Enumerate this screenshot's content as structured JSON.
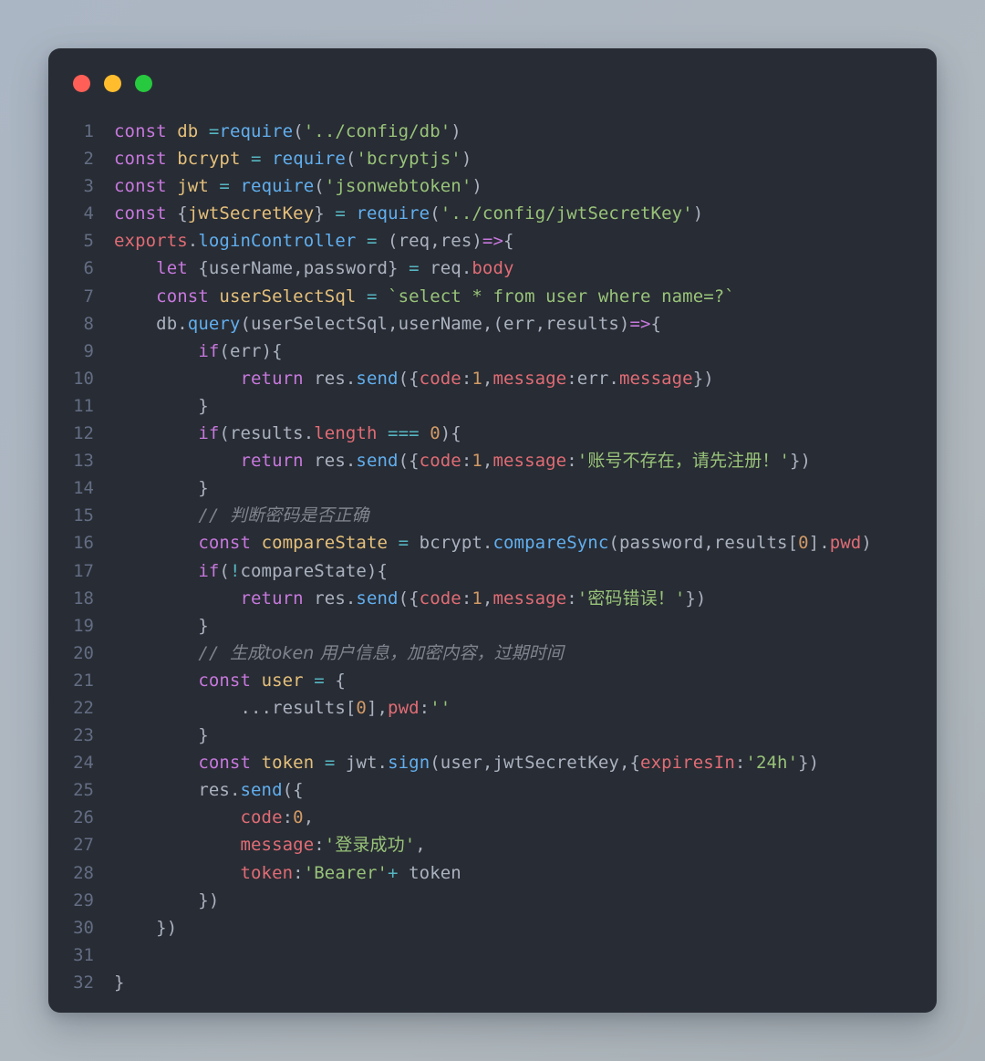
{
  "window": {
    "traffic_lights": [
      {
        "name": "close",
        "color": "#ff5f56"
      },
      {
        "name": "minimize",
        "color": "#ffbd2e"
      },
      {
        "name": "maximize",
        "color": "#27c93f"
      }
    ],
    "background_color": "#282c34",
    "page_background_color": "#aeb7c0"
  },
  "editor": {
    "language": "javascript",
    "theme": "One Dark Pro",
    "line_number_color": "#636d83",
    "total_lines": 32,
    "palette": {
      "keyword": "#c678dd",
      "function": "#61afef",
      "string": "#98c379",
      "number": "#d19a66",
      "variable": "#e5c07b",
      "property": "#e06c75",
      "operator": "#56b6c2",
      "plain": "#abb2bf",
      "comment": "#7f848e"
    },
    "lines": [
      {
        "n": "1",
        "text": "const db =require('../config/db')"
      },
      {
        "n": "2",
        "text": "const bcrypt = require('bcryptjs')"
      },
      {
        "n": "3",
        "text": "const jwt = require('jsonwebtoken')"
      },
      {
        "n": "4",
        "text": "const {jwtSecretKey} = require('../config/jwtSecretKey')"
      },
      {
        "n": "5",
        "text": "exports.loginController = (req,res)=>{"
      },
      {
        "n": "6",
        "text": "    let {userName,password} = req.body"
      },
      {
        "n": "7",
        "text": "    const userSelectSql = `select * from user where name=?`"
      },
      {
        "n": "8",
        "text": "    db.query(userSelectSql,userName,(err,results)=>{"
      },
      {
        "n": "9",
        "text": "        if(err){"
      },
      {
        "n": "10",
        "text": "            return res.send({code:1,message:err.message})"
      },
      {
        "n": "11",
        "text": "        }"
      },
      {
        "n": "12",
        "text": "        if(results.length === 0){"
      },
      {
        "n": "13",
        "text": "            return res.send({code:1,message:'账号不存在，请先注册！'})"
      },
      {
        "n": "14",
        "text": "        }"
      },
      {
        "n": "15",
        "text": "        // 判断密码是否正确"
      },
      {
        "n": "16",
        "text": "        const compareState = bcrypt.compareSync(password,results[0].pwd)"
      },
      {
        "n": "17",
        "text": "        if(!compareState){"
      },
      {
        "n": "18",
        "text": "            return res.send({code:1,message:'密码错误！'})"
      },
      {
        "n": "19",
        "text": "        }"
      },
      {
        "n": "20",
        "text": "        // 生成token 用户信息，加密内容，过期时间"
      },
      {
        "n": "21",
        "text": "        const user = {"
      },
      {
        "n": "22",
        "text": "            ...results[0],pwd:''"
      },
      {
        "n": "23",
        "text": "        }"
      },
      {
        "n": "24",
        "text": "        const token = jwt.sign(user,jwtSecretKey,{expiresIn:'24h'})"
      },
      {
        "n": "25",
        "text": "        res.send({"
      },
      {
        "n": "26",
        "text": "            code:0,"
      },
      {
        "n": "27",
        "text": "            message:'登录成功',"
      },
      {
        "n": "28",
        "text": "            token:'Bearer'+ token"
      },
      {
        "n": "29",
        "text": "        })"
      },
      {
        "n": "30",
        "text": "    })"
      },
      {
        "n": "31",
        "text": ""
      },
      {
        "n": "32",
        "text": "}"
      }
    ]
  }
}
